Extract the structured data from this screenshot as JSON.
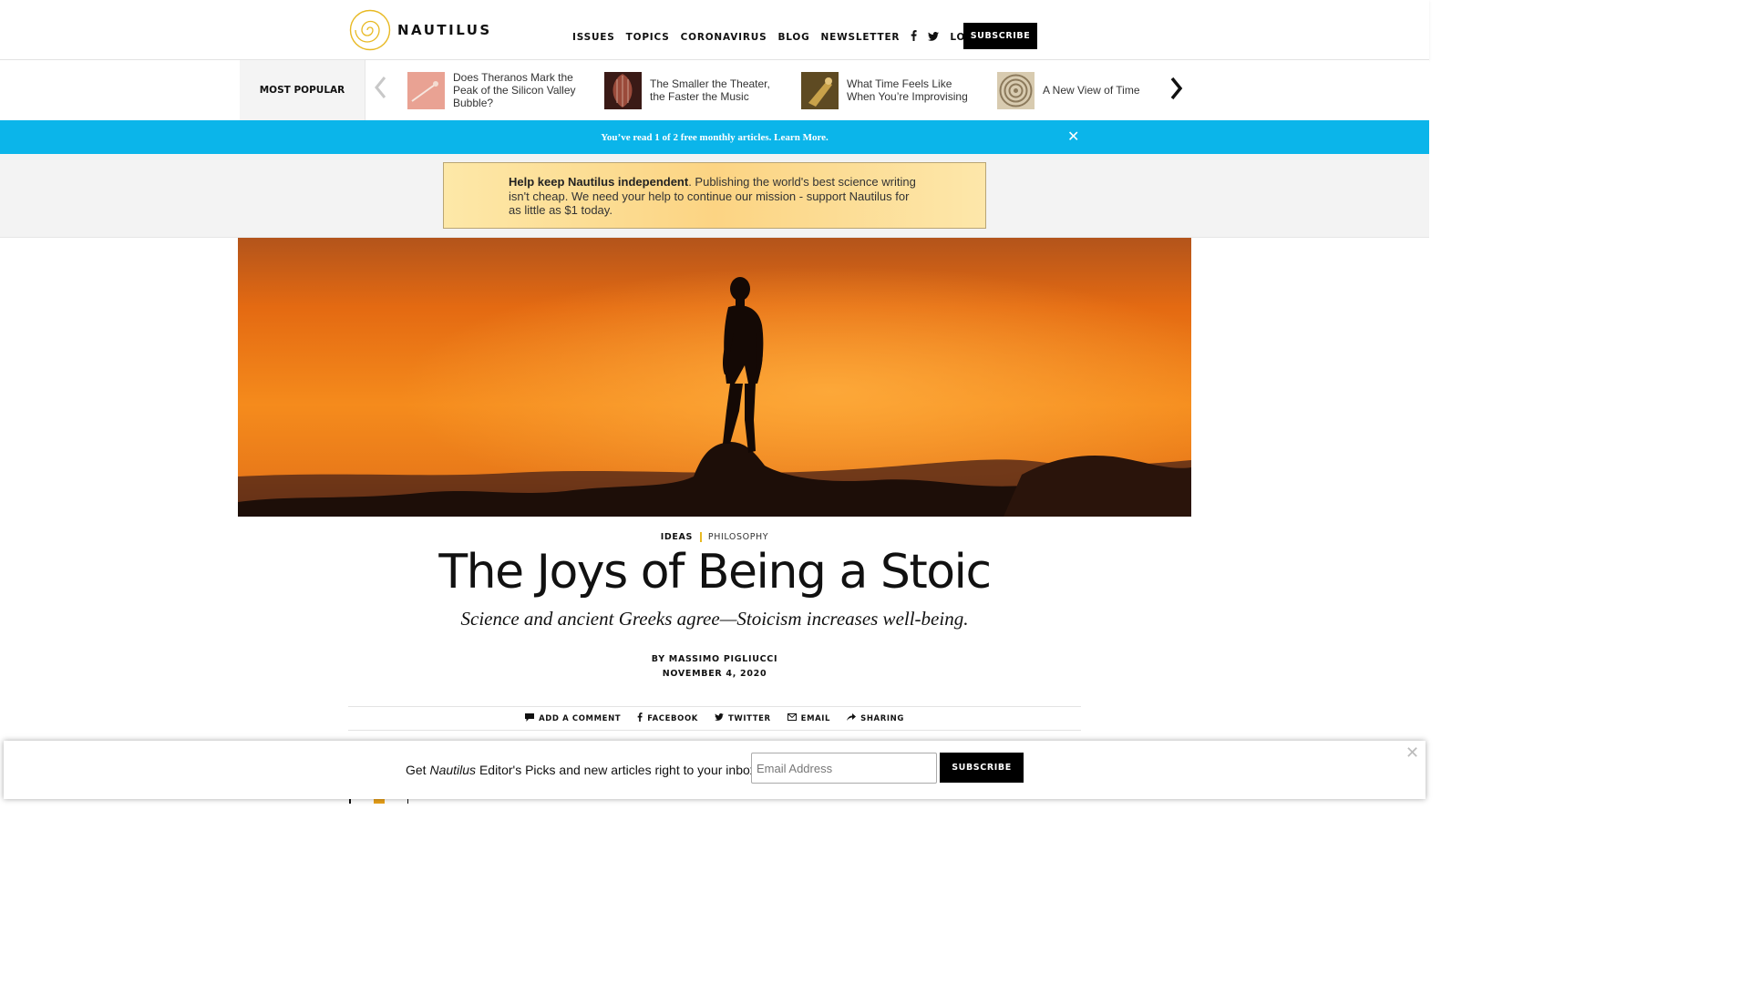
{
  "header": {
    "logo_text": "NAUTILUS",
    "nav": [
      "ISSUES",
      "TOPICS",
      "CORONAVIRUS",
      "BLOG",
      "NEWSLETTER"
    ],
    "facebook_icon": "f",
    "twitter_icon": "🐦",
    "login": "LOGIN",
    "subscribe": "SUBSCRIBE"
  },
  "most_popular": {
    "label": "MOST POPULAR",
    "prev_icon": "‹",
    "next_icon": "›",
    "items": [
      {
        "title": "Does Theranos Mark the Peak of the Silicon Valley Bubble?"
      },
      {
        "title": "The Smaller the Theater, the Faster the Music"
      },
      {
        "title": "What Time Feels Like When You’re Improvising"
      },
      {
        "title": "A New View of Time"
      }
    ]
  },
  "paywall_bar": {
    "text": "You’ve read 1 of 2 free monthly articles.",
    "link": "Learn More.",
    "close": "✕"
  },
  "donate": {
    "bold": "Help keep Nautilus independent",
    "text": ". Publishing the world's best science writing isn't cheap. We need your help to continue our mission - support Nautilus for as little as $1 today."
  },
  "article": {
    "category": "IDEAS",
    "subcategory": "PHILOSOPHY",
    "title": "The Joys of Being a Stoic",
    "subtitle": "Science and ancient Greeks agree—Stoicism increases well-being.",
    "byline": "BY MASSIMO PIGLIUCCI",
    "date": "NOVEMBER 4, 2020"
  },
  "share": [
    {
      "icon": "💬",
      "label": "ADD A COMMENT",
      "name": "comment"
    },
    {
      "icon": "f",
      "label": "FACEBOOK",
      "name": "facebook"
    },
    {
      "icon": "🐦",
      "label": "TWITTER",
      "name": "twitter"
    },
    {
      "icon": "✉",
      "label": "EMAIL",
      "name": "email"
    },
    {
      "icon": "➦",
      "label": "SHARING",
      "name": "sharing"
    }
  ],
  "newsletter": {
    "text_prefix": "Get ",
    "text_italic": "Nautilus",
    "text_suffix": " Editor's Picks and new articles right to your inbox!",
    "placeholder": "Email Address",
    "button": "SUBSCRIBE",
    "close": "✕"
  },
  "colors": {
    "brand_gold": "#e8b923",
    "bar_blue": "#0bb5ea",
    "hero_orange": "#f07d10"
  }
}
